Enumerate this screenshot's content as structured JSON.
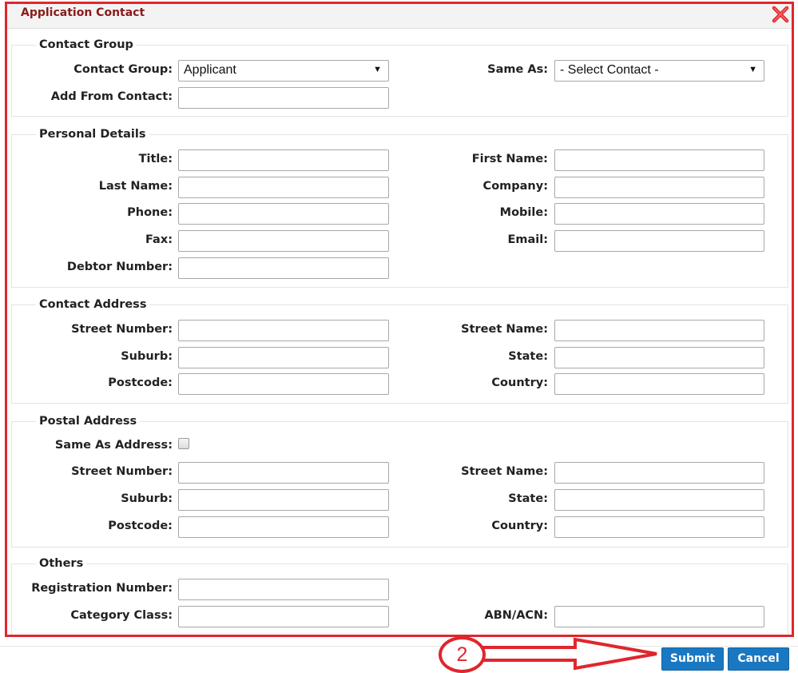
{
  "dialog": {
    "title": "Application Contact"
  },
  "contact_group": {
    "legend": "Contact Group",
    "group_label": "Contact Group:",
    "group_value": "Applicant",
    "same_as_label": "Same As:",
    "same_as_value": "- Select Contact -",
    "add_from_label": "Add From Contact:",
    "add_from_value": ""
  },
  "personal": {
    "legend": "Personal Details",
    "title_label": "Title:",
    "first_name_label": "First Name:",
    "last_name_label": "Last Name:",
    "company_label": "Company:",
    "phone_label": "Phone:",
    "mobile_label": "Mobile:",
    "fax_label": "Fax:",
    "email_label": "Email:",
    "debtor_label": "Debtor Number:"
  },
  "contact_address": {
    "legend": "Contact Address",
    "street_number_label": "Street Number:",
    "street_name_label": "Street Name:",
    "suburb_label": "Suburb:",
    "state_label": "State:",
    "postcode_label": "Postcode:",
    "country_label": "Country:"
  },
  "postal_address": {
    "legend": "Postal Address",
    "same_as_address_label": "Same As Address:",
    "same_as_address_checked": false,
    "street_number_label": "Street Number:",
    "street_name_label": "Street Name:",
    "suburb_label": "Suburb:",
    "state_label": "State:",
    "postcode_label": "Postcode:",
    "country_label": "Country:"
  },
  "others": {
    "legend": "Others",
    "registration_label": "Registration Number:",
    "category_label": "Category Class:",
    "abn_label": "ABN/ACN:"
  },
  "footer": {
    "submit_label": "Submit",
    "cancel_label": "Cancel"
  },
  "annotation": {
    "step_number": "2"
  },
  "colors": {
    "title": "#8b1a1a",
    "annotation": "#e0262d",
    "button": "#1a78c2"
  },
  "icons": {
    "close": "close-x-icon",
    "dropdown": "triangle-down-icon",
    "arrow": "right-arrow-icon"
  }
}
